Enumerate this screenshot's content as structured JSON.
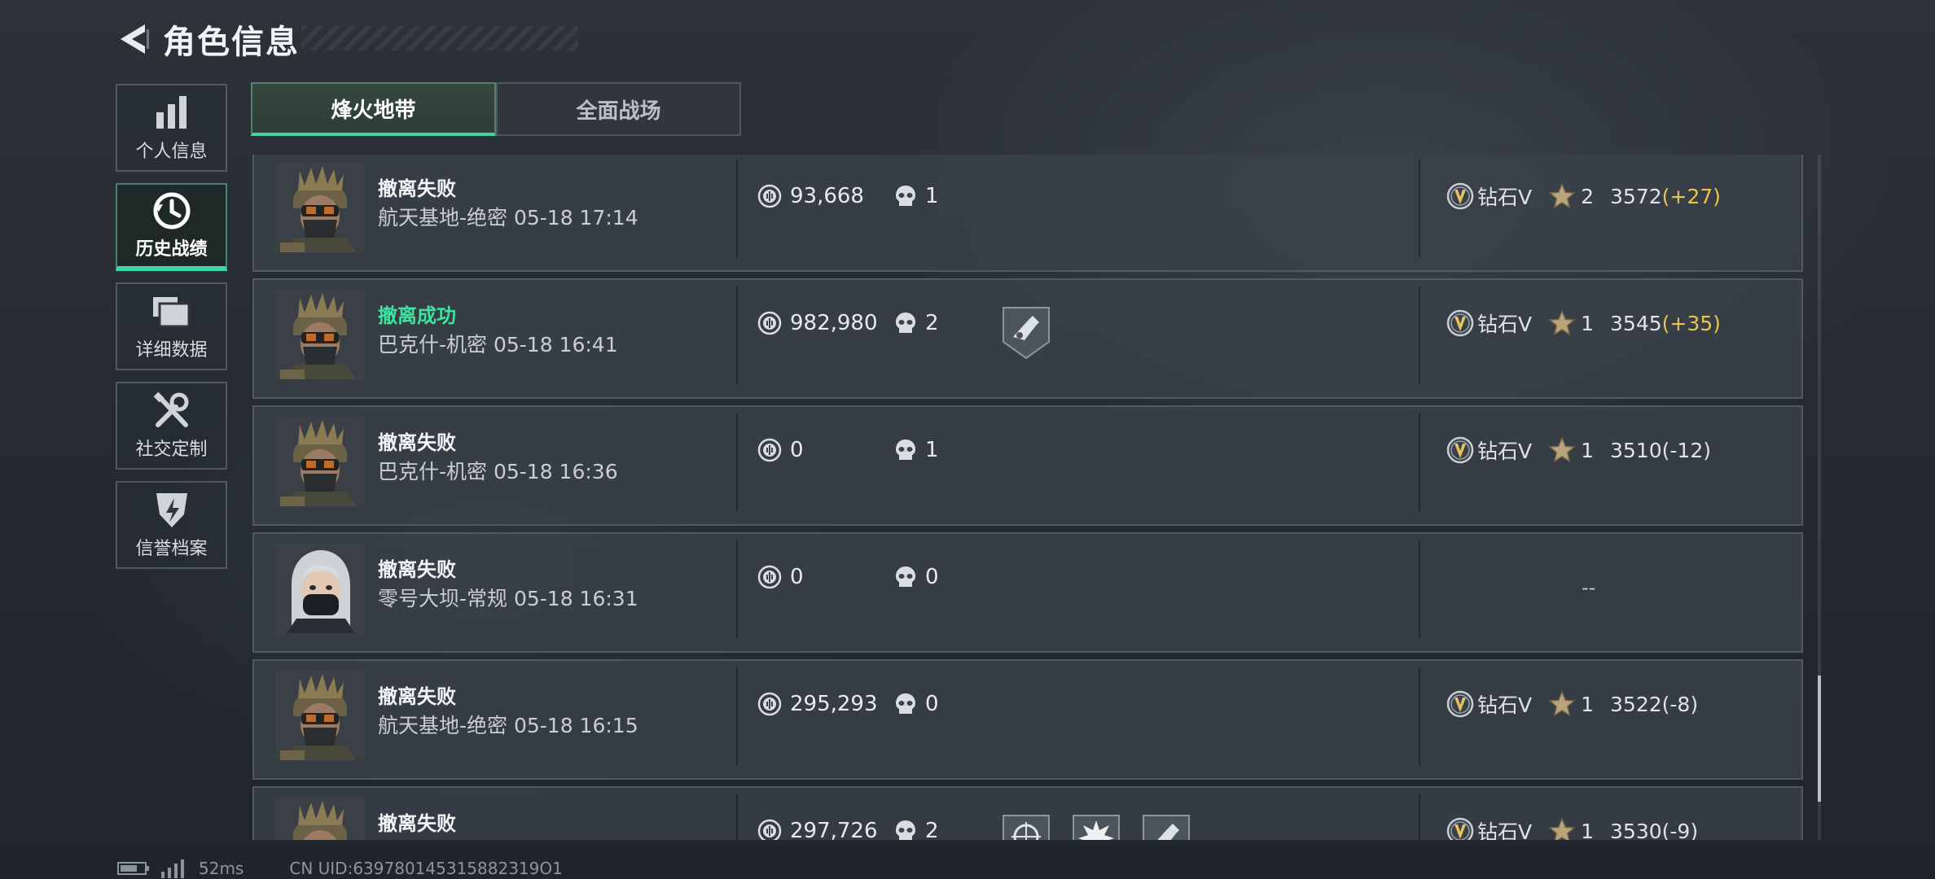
{
  "header": {
    "title": "角色信息"
  },
  "sidebar": {
    "items": [
      {
        "label": "个人信息",
        "icon": "bar-chart-icon"
      },
      {
        "label": "历史战绩",
        "icon": "history-clock-icon",
        "active": true
      },
      {
        "label": "详细数据",
        "icon": "folder-icon"
      },
      {
        "label": "社交定制",
        "icon": "tools-icon"
      },
      {
        "label": "信誉档案",
        "icon": "reputation-icon"
      }
    ]
  },
  "tabs": [
    {
      "label": "烽火地带",
      "active": true
    },
    {
      "label": "全面战场",
      "active": false
    }
  ],
  "matches": [
    {
      "outcome": "撤离失败",
      "success": false,
      "detail": "航天基地-绝密 05-18 17:14",
      "avatar": "soldier-avatar",
      "money": "93,668",
      "kills": "1",
      "badges": [],
      "rank": "钻石V",
      "stars": "2",
      "score": "3572",
      "delta": "(+27)"
    },
    {
      "outcome": "撤离成功",
      "success": true,
      "detail": "巴克什-机密 05-18 16:41",
      "avatar": "soldier-avatar",
      "money": "982,980",
      "kills": "2",
      "badges": [
        "rescue-medal-icon"
      ],
      "rank": "钻石V",
      "stars": "1",
      "score": "3545",
      "delta": "(+35)"
    },
    {
      "outcome": "撤离失败",
      "success": false,
      "detail": "巴克什-机密 05-18 16:36",
      "avatar": "soldier-avatar",
      "money": "0",
      "kills": "1",
      "badges": [],
      "rank": "钻石V",
      "stars": "1",
      "score": "3510",
      "delta": "(-12)"
    },
    {
      "outcome": "撤离失败",
      "success": false,
      "detail": "零号大坝-常规 05-18 16:31",
      "avatar": "female-operator-avatar",
      "money": "0",
      "kills": "0",
      "badges": [],
      "rank": "",
      "no_rank": "--"
    },
    {
      "outcome": "撤离失败",
      "success": false,
      "detail": "航天基地-绝密 05-18 16:15",
      "avatar": "soldier-avatar",
      "money": "295,293",
      "kills": "0",
      "badges": [],
      "rank": "钻石V",
      "stars": "1",
      "score": "3522",
      "delta": "(-8)"
    },
    {
      "outcome": "撤离失败",
      "success": false,
      "detail": "",
      "avatar": "soldier-avatar",
      "money": "297,726",
      "kills": "2",
      "badges": [
        "scope-medal-icon",
        "explosion-medal-icon",
        "rescue-medal-icon"
      ],
      "rank": "钻石V",
      "stars": "1",
      "score": "3530",
      "delta": "(-9)"
    }
  ],
  "status": {
    "ping": "52ms",
    "uid": "CN UID:639780145315882319O1"
  }
}
